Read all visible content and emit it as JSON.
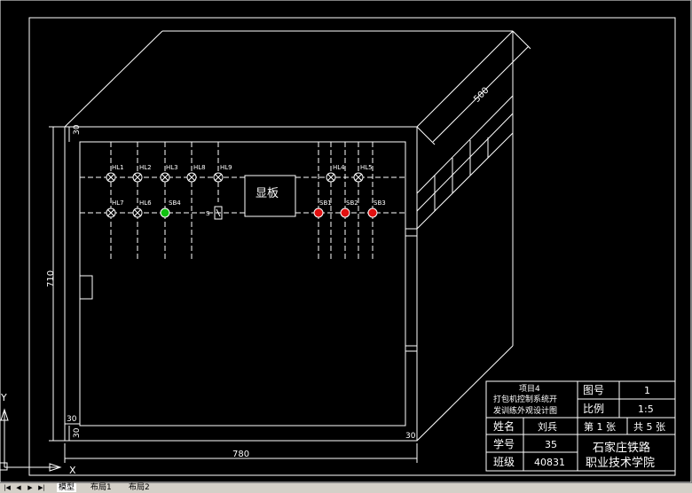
{
  "drawing": {
    "panel_label": "显板",
    "dims": {
      "depth": "500",
      "height": "710",
      "width": "780",
      "top_margin": "30",
      "left_margin": "30",
      "bottom_margin": "30",
      "right_margin": "30"
    },
    "lamps_row1": [
      "HL1",
      "HL2",
      "HL3",
      "HL8",
      "HL9"
    ],
    "lamps_row1_right": [
      "HL4",
      "HL5"
    ],
    "lamps_row2": [
      "HL7",
      "HL6"
    ],
    "button_green": "SB4",
    "switch_label": "S",
    "buttons_red": [
      "SB1",
      "SB2",
      "SB3"
    ],
    "ucs": {
      "y": "Y",
      "x": "X"
    }
  },
  "title_block": {
    "project_line1": "项目4",
    "project_line2": "打包机控制系统开",
    "project_line3": "发训练外观设计图",
    "drawing_no_label": "图号",
    "drawing_no": "1",
    "scale_label": "比例",
    "scale": "1:5",
    "sheet": "第 1 张",
    "total": "共 5 张",
    "name_label": "姓名",
    "name": "刘兵",
    "id_label": "学号",
    "id": "35",
    "class_label": "班级",
    "class": "40831",
    "school_line1": "石家庄铁路",
    "school_line2": "职业技术学院"
  },
  "tabs": [
    {
      "label": "模型",
      "active": true
    },
    {
      "label": "布局1",
      "active": false
    },
    {
      "label": "布局2",
      "active": false
    }
  ],
  "colors": {
    "bg": "#000000",
    "line": "#ffffff",
    "red": "#e01010",
    "green": "#10c010"
  }
}
